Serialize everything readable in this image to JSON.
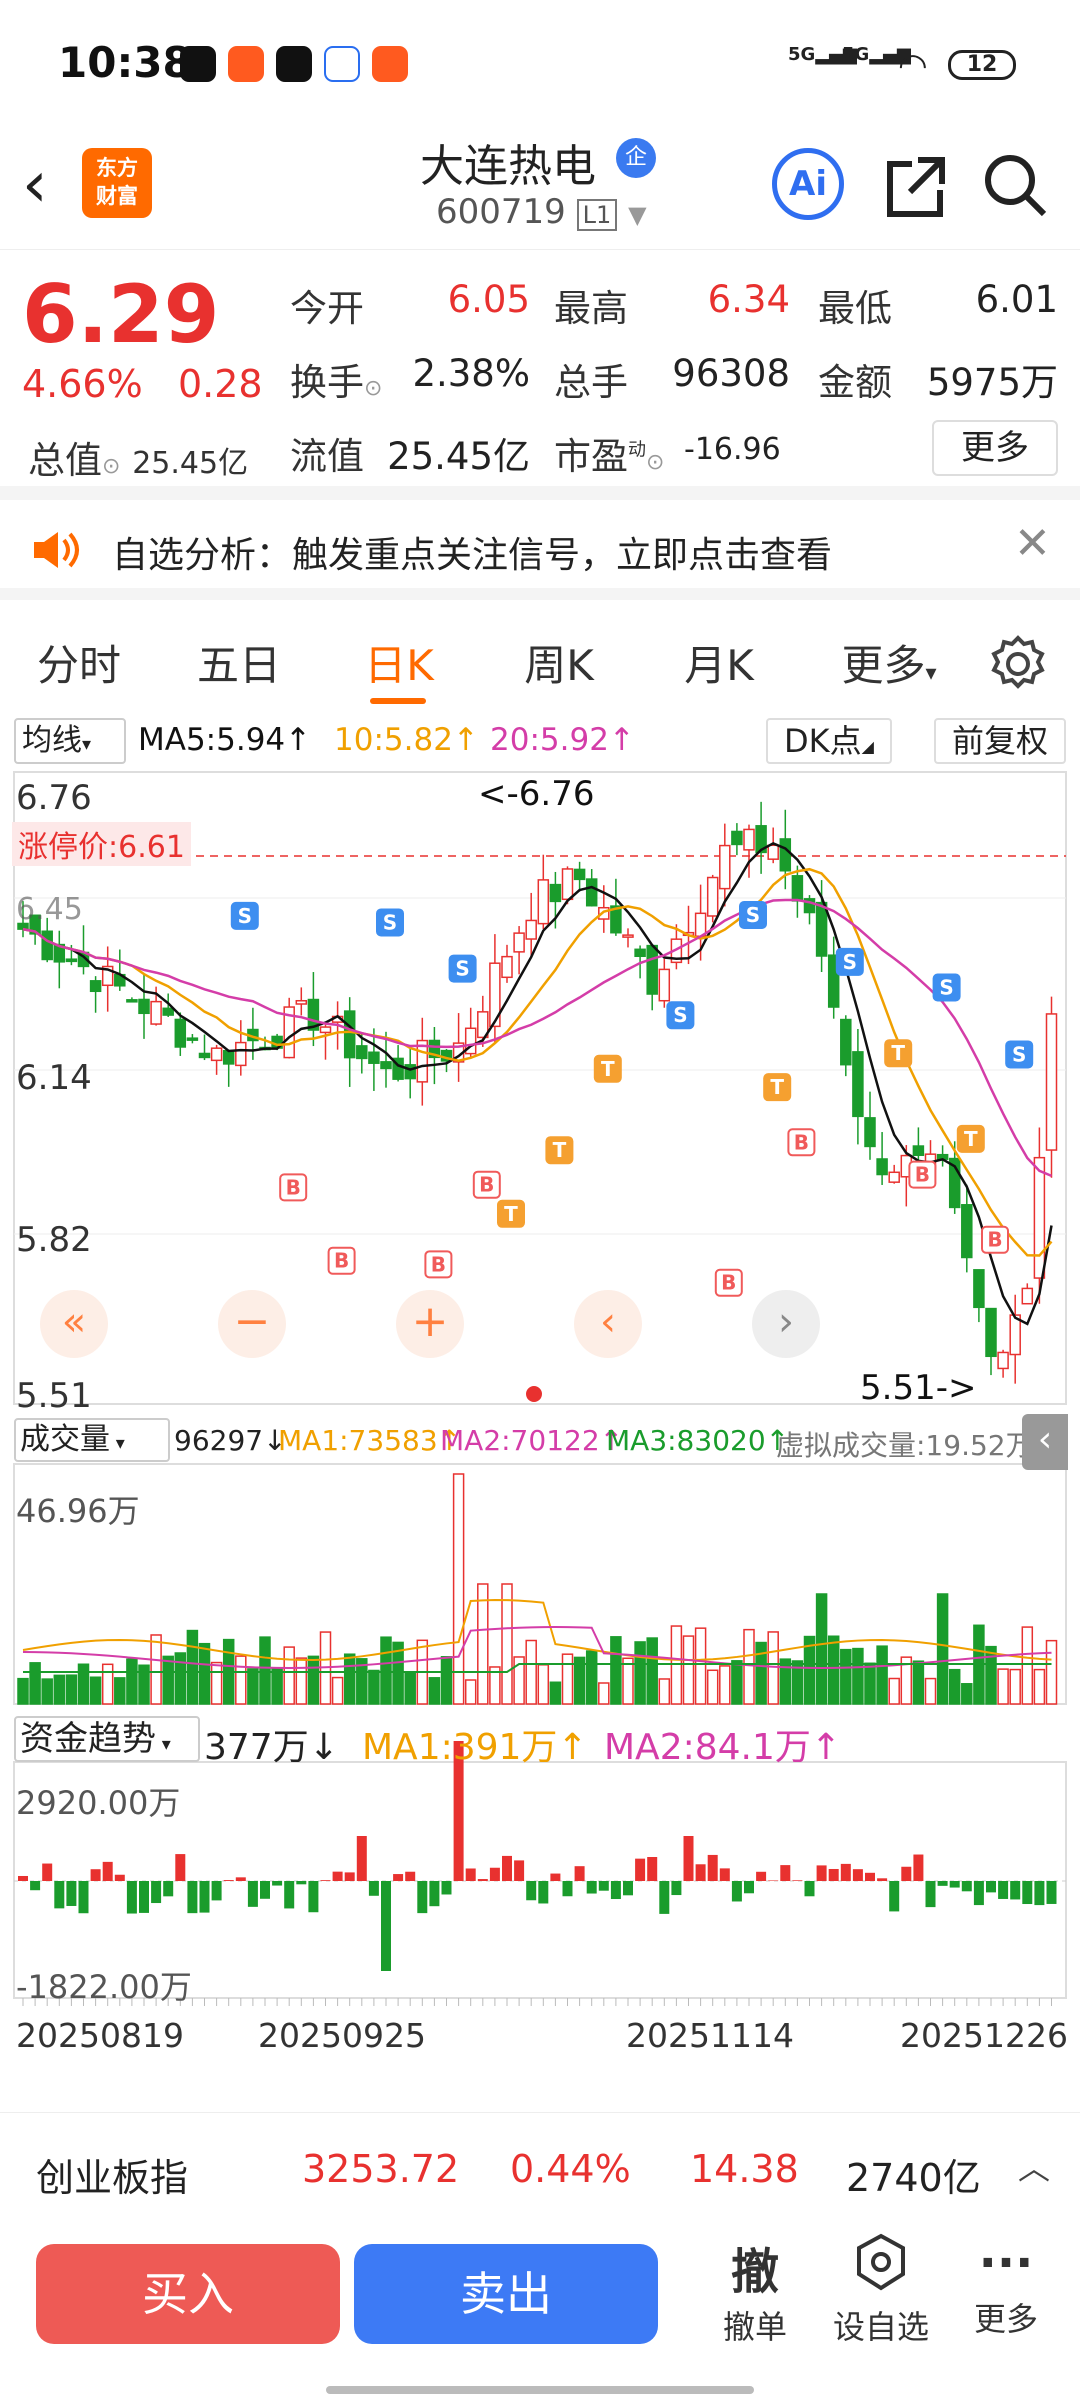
{
  "status": {
    "time": "10:38",
    "net1": "5G",
    "net2": "5G",
    "battery": "12"
  },
  "nav": {
    "stock_name": "大连热电",
    "badge": "企",
    "code": "600719",
    "level": "L1",
    "ai": "Ai",
    "logo_line1": "东方",
    "logo_line2": "财富"
  },
  "quote": {
    "price": "6.29",
    "pct": "4.66%",
    "chg": "0.28",
    "open_label": "今开",
    "open": "6.05",
    "high_label": "最高",
    "high": "6.34",
    "low_label": "最低",
    "low": "6.01",
    "turnover_label": "换手",
    "turnover": "2.38%",
    "volume_label": "总手",
    "volume": "96308",
    "amount_label": "金额",
    "amount": "5975万",
    "mcap_label": "总值",
    "mcap": "25.45亿",
    "float_label": "流值",
    "float": "25.45亿",
    "pe_label": "市盈",
    "pe_sup": "动",
    "pe": "-16.96",
    "more": "更多"
  },
  "banner": {
    "text": "自选分析：触发重点关注信号，立即点击查看"
  },
  "tabs": [
    "分时",
    "五日",
    "日K",
    "周K",
    "月K",
    "更多"
  ],
  "active_tab": 2,
  "colors": {
    "up": "#e8312f",
    "down": "#1a9c2c",
    "accent": "#ff6a00",
    "ma5": "#111111",
    "ma10": "#f0a000",
    "ma20": "#d43da8",
    "buy": "#2f7cf6",
    "sell": "#f05a5a"
  },
  "ma_bar": {
    "selector": "均线",
    "ma5": "MA5:5.94↑",
    "ma10": "10:5.82↑",
    "ma20": "20:5.92↑",
    "dk": "DK点",
    "adjust": "前复权"
  },
  "kline": {
    "y_max": "6.76",
    "y_mid1": "6.14",
    "y_mid2": "5.82",
    "y_min": "5.51",
    "limit": "涨停价:6.61",
    "hi_tag": "<-6.76",
    "lo_tag": "5.51->",
    "y_partial": "6.45"
  },
  "vol_bar": {
    "selector": "成交量",
    "value": "96297↓",
    "ma1": "MA1:73583↑",
    "ma2": "MA2:70122↑",
    "ma3": "MA3:83020↑",
    "virtual": "虚拟成交量:19.52万",
    "ymax": "46.96万"
  },
  "fund_bar": {
    "selector": "资金趋势",
    "value": "377万↓",
    "ma1": "MA1:391万↑",
    "ma2": "MA2:84.1万↑",
    "ymax": "2920.00万",
    "ymin": "-1822.00万"
  },
  "dates": [
    "20250819",
    "20250925",
    "20251114",
    "20251226"
  ],
  "index": {
    "name": "创业板指",
    "value": "3253.72",
    "pct": "0.44%",
    "chg": "14.38",
    "amount": "2740亿"
  },
  "actions": {
    "buy": "买入",
    "sell": "卖出",
    "cancel_big": "撤",
    "cancel": "撤单",
    "fav": "设自选",
    "more": "更多"
  }
}
